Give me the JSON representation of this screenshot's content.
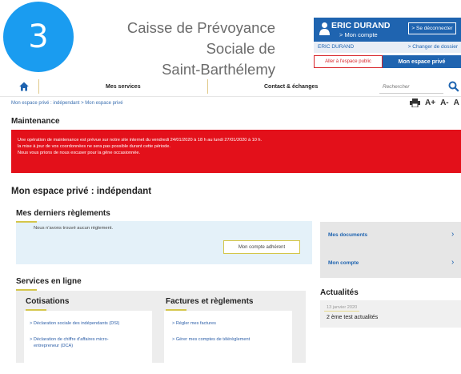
{
  "step_badge": "3",
  "site": {
    "title_line1": "Caisse de Prévoyance Sociale de",
    "title_line2": "Saint-Barthélemy"
  },
  "account": {
    "name": "ERIC DURAND",
    "subtitle": "> Mon compte",
    "logout_label": "> Se déconnecter",
    "id_label": "ERIC DURAND",
    "change_label": "> Changer de dossier",
    "public_tab": "Aller à l'espace public",
    "private_tab": "Mon espace privé"
  },
  "nav": {
    "services": "Mes services",
    "contact": "Contact & échanges",
    "search_placeholder": "Rechercher"
  },
  "breadcrumb": {
    "part1": "Mon espace privé : indépendant",
    "sep": " > ",
    "part2": "Mon espace privé"
  },
  "tools": {
    "font_increase": "A+",
    "font_decrease": "A-",
    "font_reset": "A"
  },
  "maintenance": {
    "title": "Maintenance",
    "line1": "Une opération de maintenance est prévue sur notre site internet du vendredi 24/01/2020 à 18 h au lundi 27/01/2020 à 10 h.",
    "line2": "la mise à jour de vos coordonnées ne sera pas possible durant cette période.",
    "line3": "Nous vous prions de nous excuser pour la gêne occasionnée."
  },
  "page_title": "Mon espace privé : indépendant",
  "reglements": {
    "title": "Mes derniers règlements",
    "empty_message": "Nous n'avons trouvé aucun règlement.",
    "button": "Mon compte adhérent"
  },
  "side_links": [
    {
      "label": "Mes documents"
    },
    {
      "label": "Mon compte"
    }
  ],
  "services": {
    "title": "Services en ligne",
    "cotisations": {
      "title": "Cotisations",
      "link1": "> Déclaration sociale des indépendants (DSI)",
      "link2a": "> Déclaration de chiffre d'affaires micro-",
      "link2b": "entrepreneur (DCA)"
    },
    "factures": {
      "title": "Factures et règlements",
      "link1": "> Régler mes factures",
      "link2": "> Gérer mes comptes de télérèglement"
    }
  },
  "actualites": {
    "title": "Actualités",
    "date": "13 janvier 2020",
    "text": "2 ème test actualités"
  },
  "colors": {
    "brand_blue": "#1f64b0",
    "alert_red": "#e3101a",
    "accent_gold": "#d4c64a",
    "badge_blue": "#1a9cf0"
  }
}
